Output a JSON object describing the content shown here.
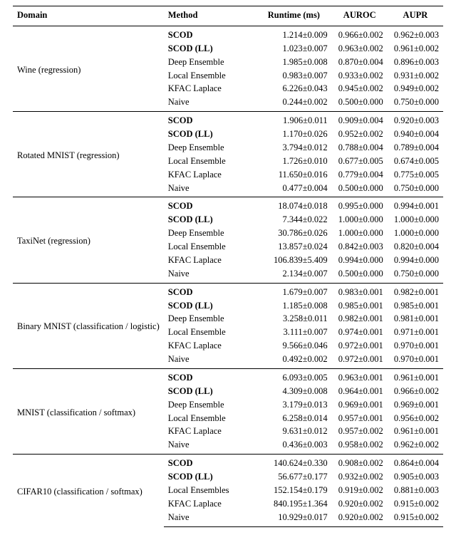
{
  "chart_data": {
    "type": "table",
    "columns": [
      "Domain",
      "Method",
      "Runtime (ms)",
      "AUROC",
      "AUPR"
    ],
    "groups": [
      {
        "domain": "Wine (regression)",
        "rows": [
          {
            "method": "SCOD",
            "bold": true,
            "runtime": "1.214±0.009",
            "auroc": "0.966±0.002",
            "aupr": "0.962±0.003"
          },
          {
            "method": "SCOD (LL)",
            "bold": true,
            "runtime": "1.023±0.007",
            "auroc": "0.963±0.002",
            "aupr": "0.961±0.002"
          },
          {
            "method": "Deep Ensemble",
            "bold": false,
            "runtime": "1.985±0.008",
            "auroc": "0.870±0.004",
            "aupr": "0.896±0.003"
          },
          {
            "method": "Local Ensemble",
            "bold": false,
            "runtime": "0.983±0.007",
            "auroc": "0.933±0.002",
            "aupr": "0.931±0.002"
          },
          {
            "method": "KFAC Laplace",
            "bold": false,
            "runtime": "6.226±0.043",
            "auroc": "0.945±0.002",
            "aupr": "0.949±0.002"
          },
          {
            "method": "Naive",
            "bold": false,
            "runtime": "0.244±0.002",
            "auroc": "0.500±0.000",
            "aupr": "0.750±0.000"
          }
        ]
      },
      {
        "domain": "Rotated MNIST (regression)",
        "rows": [
          {
            "method": "SCOD",
            "bold": true,
            "runtime": "1.906±0.011",
            "auroc": "0.909±0.004",
            "aupr": "0.920±0.003"
          },
          {
            "method": "SCOD (LL)",
            "bold": true,
            "runtime": "1.170±0.026",
            "auroc": "0.952±0.002",
            "aupr": "0.940±0.004"
          },
          {
            "method": "Deep Ensemble",
            "bold": false,
            "runtime": "3.794±0.012",
            "auroc": "0.788±0.004",
            "aupr": "0.789±0.004"
          },
          {
            "method": "Local Ensemble",
            "bold": false,
            "runtime": "1.726±0.010",
            "auroc": "0.677±0.005",
            "aupr": "0.674±0.005"
          },
          {
            "method": "KFAC Laplace",
            "bold": false,
            "runtime": "11.650±0.016",
            "auroc": "0.779±0.004",
            "aupr": "0.775±0.005"
          },
          {
            "method": "Naive",
            "bold": false,
            "runtime": "0.477±0.004",
            "auroc": "0.500±0.000",
            "aupr": "0.750±0.000"
          }
        ]
      },
      {
        "domain": "TaxiNet (regression)",
        "rows": [
          {
            "method": "SCOD",
            "bold": true,
            "runtime": "18.074±0.018",
            "auroc": "0.995±0.000",
            "aupr": "0.994±0.001"
          },
          {
            "method": "SCOD (LL)",
            "bold": true,
            "runtime": "7.344±0.022",
            "auroc": "1.000±0.000",
            "aupr": "1.000±0.000"
          },
          {
            "method": "Deep Ensemble",
            "bold": false,
            "runtime": "30.786±0.026",
            "auroc": "1.000±0.000",
            "aupr": "1.000±0.000"
          },
          {
            "method": "Local Ensemble",
            "bold": false,
            "runtime": "13.857±0.024",
            "auroc": "0.842±0.003",
            "aupr": "0.820±0.004"
          },
          {
            "method": "KFAC Laplace",
            "bold": false,
            "runtime": "106.839±5.409",
            "auroc": "0.994±0.000",
            "aupr": "0.994±0.000"
          },
          {
            "method": "Naive",
            "bold": false,
            "runtime": "2.134±0.007",
            "auroc": "0.500±0.000",
            "aupr": "0.750±0.000"
          }
        ]
      },
      {
        "domain": "Binary MNIST (classification / logistic)",
        "rows": [
          {
            "method": "SCOD",
            "bold": true,
            "runtime": "1.679±0.007",
            "auroc": "0.983±0.001",
            "aupr": "0.982±0.001"
          },
          {
            "method": "SCOD (LL)",
            "bold": true,
            "runtime": "1.185±0.008",
            "auroc": "0.985±0.001",
            "aupr": "0.985±0.001"
          },
          {
            "method": "Deep Ensemble",
            "bold": false,
            "runtime": "3.258±0.011",
            "auroc": "0.982±0.001",
            "aupr": "0.981±0.001"
          },
          {
            "method": "Local Ensemble",
            "bold": false,
            "runtime": "3.111±0.007",
            "auroc": "0.974±0.001",
            "aupr": "0.971±0.001"
          },
          {
            "method": "KFAC Laplace",
            "bold": false,
            "runtime": "9.566±0.046",
            "auroc": "0.972±0.001",
            "aupr": "0.970±0.001"
          },
          {
            "method": "Naive",
            "bold": false,
            "runtime": "0.492±0.002",
            "auroc": "0.972±0.001",
            "aupr": "0.970±0.001"
          }
        ]
      },
      {
        "domain": "MNIST (classification / softmax)",
        "rows": [
          {
            "method": "SCOD",
            "bold": true,
            "runtime": "6.093±0.005",
            "auroc": "0.963±0.001",
            "aupr": "0.961±0.001"
          },
          {
            "method": "SCOD (LL)",
            "bold": true,
            "runtime": "4.309±0.008",
            "auroc": "0.964±0.001",
            "aupr": "0.966±0.002"
          },
          {
            "method": "Deep Ensemble",
            "bold": false,
            "runtime": "3.179±0.013",
            "auroc": "0.969±0.001",
            "aupr": "0.969±0.001"
          },
          {
            "method": "Local Ensemble",
            "bold": false,
            "runtime": "6.258±0.014",
            "auroc": "0.957±0.001",
            "aupr": "0.956±0.002"
          },
          {
            "method": "KFAC Laplace",
            "bold": false,
            "runtime": "9.631±0.012",
            "auroc": "0.957±0.002",
            "aupr": "0.961±0.001"
          },
          {
            "method": "Naive",
            "bold": false,
            "runtime": "0.436±0.003",
            "auroc": "0.958±0.002",
            "aupr": "0.962±0.002"
          }
        ]
      },
      {
        "domain": "CIFAR10 (classification / softmax)",
        "rows": [
          {
            "method": "SCOD",
            "bold": true,
            "runtime": "140.624±0.330",
            "auroc": "0.908±0.002",
            "aupr": "0.864±0.004"
          },
          {
            "method": "SCOD (LL)",
            "bold": true,
            "runtime": "56.677±0.177",
            "auroc": "0.932±0.002",
            "aupr": "0.905±0.003"
          },
          {
            "method": "Local Ensembles",
            "bold": false,
            "runtime": "152.154±0.179",
            "auroc": "0.919±0.002",
            "aupr": "0.881±0.003"
          },
          {
            "method": "KFAC Laplace",
            "bold": false,
            "runtime": "840.195±1.364",
            "auroc": "0.920±0.002",
            "aupr": "0.915±0.002"
          },
          {
            "method": "Naive",
            "bold": false,
            "runtime": "10.929±0.017",
            "auroc": "0.920±0.002",
            "aupr": "0.915±0.002"
          }
        ]
      }
    ]
  }
}
